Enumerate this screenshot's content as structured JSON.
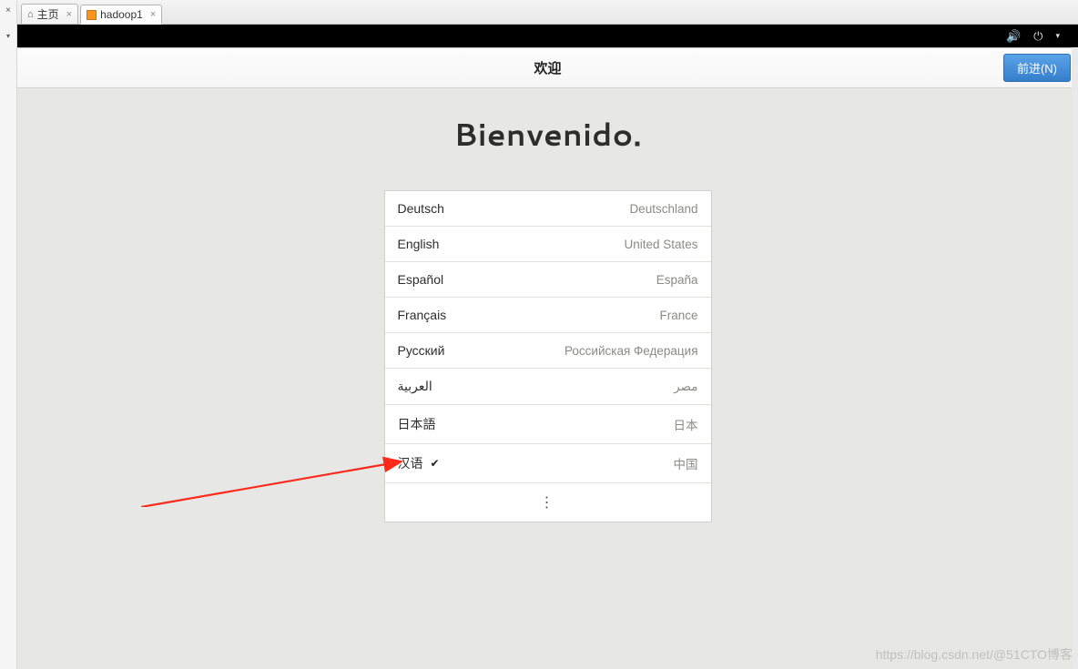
{
  "sidebar": {
    "close_glyph": "×",
    "dropdown_glyph": "▾"
  },
  "tabs": {
    "home": {
      "label": "主页"
    },
    "vm": {
      "label": "hadoop1"
    }
  },
  "system_tray": {
    "volume_glyph": "🔊",
    "power_glyph": "⏻",
    "caret_glyph": "▾"
  },
  "header": {
    "title": "欢迎",
    "forward_button": "前进(N)"
  },
  "welcome": {
    "big_title": "Bienvenido."
  },
  "languages": [
    {
      "name": "Deutsch",
      "region": "Deutschland",
      "selected": false
    },
    {
      "name": "English",
      "region": "United States",
      "selected": false
    },
    {
      "name": "Español",
      "region": "España",
      "selected": false
    },
    {
      "name": "Français",
      "region": "France",
      "selected": false
    },
    {
      "name": "Русский",
      "region": "Российская Федерация",
      "selected": false
    },
    {
      "name": "العربية",
      "region": "مصر",
      "selected": false
    },
    {
      "name": "日本語",
      "region": "日本",
      "selected": false
    },
    {
      "name": "汉语",
      "region": "中国",
      "selected": true
    }
  ],
  "more_glyph": "⋮",
  "check_glyph": "✔",
  "watermark": "https://blog.csdn.net/@51CTO博客"
}
